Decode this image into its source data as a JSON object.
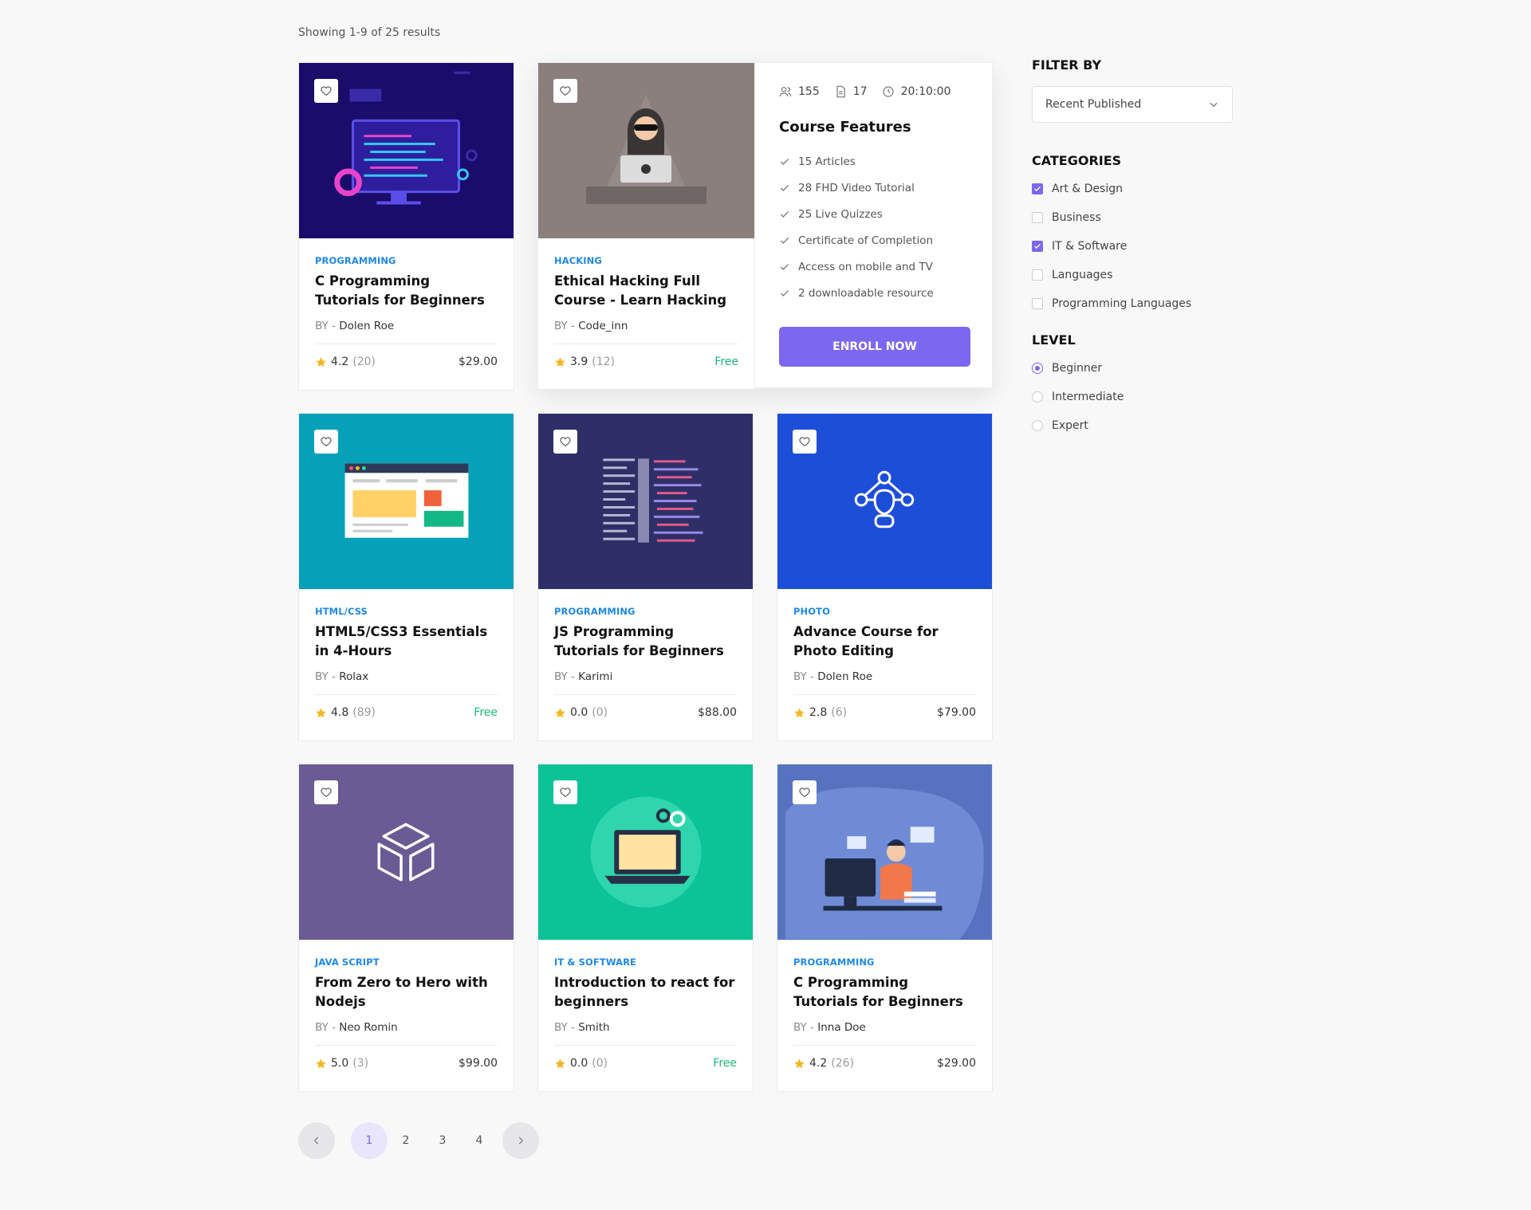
{
  "results_text": "Showing 1-9 of 25 results",
  "courses": [
    {
      "category": "PROGRAMMING",
      "title": "C Programming Tutorials for Beginners",
      "by": "BY -",
      "author": "Dolen Roe",
      "rating": "4.2",
      "reviews": "(20)",
      "price": "$29.00",
      "bg": "#1a0c6b"
    },
    {
      "category": "HACKING",
      "title": "Ethical Hacking Full Course - Learn Hacking",
      "by": "BY -",
      "author": "Code_inn",
      "rating": "3.9",
      "reviews": "(12)",
      "price": "Free",
      "bg": "#8a7f7d"
    },
    {
      "category": "HTML/CSS",
      "title": "HTML5/CSS3 Essentials in 4-Hours",
      "by": "BY -",
      "author": "Rolax",
      "rating": "4.8",
      "reviews": "(89)",
      "price": "Free",
      "bg": "#04a1b8"
    },
    {
      "category": "PROGRAMMING",
      "title": "JS Programming Tutorials for Beginners",
      "by": "BY -",
      "author": "Karimi",
      "rating": "0.0",
      "reviews": "(0)",
      "price": "$88.00",
      "bg": "#2f2f68"
    },
    {
      "category": "PHOTO",
      "title": "Advance Course for Photo Editing",
      "by": "BY -",
      "author": "Dolen Roe",
      "rating": "2.8",
      "reviews": "(6)",
      "price": "$79.00",
      "bg": "#1d4ed8"
    },
    {
      "category": "JAVA SCRIPT",
      "title": "From Zero to Hero with Nodejs",
      "by": "BY -",
      "author": "Neo Romin",
      "rating": "5.0",
      "reviews": "(3)",
      "price": "$99.00",
      "bg": "#6b5b94"
    },
    {
      "category": "IT & SOFTWARE",
      "title": "Introduction to react for beginners",
      "by": "BY -",
      "author": "Smith",
      "rating": "0.0",
      "reviews": "(0)",
      "price": "Free",
      "bg": "#0cc397"
    },
    {
      "category": "PROGRAMMING",
      "title": "C Programming Tutorials for Beginners",
      "by": "BY -",
      "author": "Inna Doe",
      "rating": "4.2",
      "reviews": "(26)",
      "price": "$29.00",
      "bg": "#5773c0"
    }
  ],
  "features": {
    "students": "155",
    "lessons": "17",
    "duration": "20:10:00",
    "title": "Course Features",
    "items": [
      "15 Articles",
      "28 FHD Video Tutorial",
      "25 Live Quizzes",
      "Certificate of Completion",
      "Access on mobile and TV",
      "2 downloadable resource"
    ],
    "enroll_label": "ENROLL NOW"
  },
  "sidebar": {
    "filter_heading": "FILTER BY",
    "sort_value": "Recent Published",
    "categories_heading": "CATEGORIES",
    "categories": [
      {
        "label": "Art & Design",
        "checked": true
      },
      {
        "label": "Business",
        "checked": false
      },
      {
        "label": "IT & Software",
        "checked": true
      },
      {
        "label": "Languages",
        "checked": false
      },
      {
        "label": "Programming Languages",
        "checked": false
      }
    ],
    "level_heading": "LEVEL",
    "levels": [
      {
        "label": "Beginner",
        "selected": true
      },
      {
        "label": "Intermediate",
        "selected": false
      },
      {
        "label": "Expert",
        "selected": false
      }
    ]
  },
  "pagination": {
    "pages": [
      "1",
      "2",
      "3",
      "4"
    ],
    "current": "1"
  },
  "colors": {
    "accent": "#7c68ee",
    "category": "#1e88e5",
    "free": "#1fb87a",
    "star": "#f5b623"
  },
  "icons": {
    "heart": "heart-icon",
    "star": "star-icon",
    "check": "check-icon",
    "users": "users-icon",
    "file": "file-icon",
    "clock": "clock-icon",
    "chevron": "chevron-down-icon"
  }
}
